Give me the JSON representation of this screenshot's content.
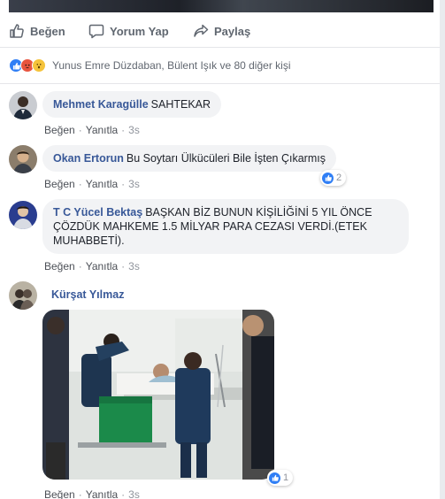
{
  "actions": {
    "like": "Beğen",
    "comment": "Yorum Yap",
    "share": "Paylaş"
  },
  "reactions": {
    "icons": [
      "like-icon",
      "angry-icon",
      "wow-icon"
    ],
    "summary": "Yunus Emre Düzdaban, Bülent Işık ve 80 diğer kişi"
  },
  "colors": {
    "link": "#385898",
    "bubble": "#f2f3f5",
    "like_blue": "#2f7ef5"
  },
  "comments": [
    {
      "author": "Mehmet Karagülle",
      "text": "SAHTEKAR",
      "like": "Beğen",
      "reply": "Yanıtla",
      "time": "3s"
    },
    {
      "author": "Okan Ertorun",
      "text": "Bu Soytarı Ülkücüleri Bile İşten Çıkarmış",
      "like": "Beğen",
      "reply": "Yanıtla",
      "time": "3s",
      "reaction_count": "2"
    },
    {
      "author": "T C Yücel Bektaş",
      "text": "BAŞKAN BİZ BUNUN KİŞİLİĞİNİ 5 YIL ÖNCE ÇÖZDÜK MAHKEME 1.5 MİLYAR PARA CEZASI VERDİ.(ETEK MUHABBETİ).",
      "like": "Beğen",
      "reply": "Yanıtla",
      "time": "3s"
    },
    {
      "author": "Kürşat Yılmaz",
      "like": "Beğen",
      "reply": "Yanıtla",
      "time": "3s",
      "reaction_count": "1",
      "photo": "hospital-photo"
    }
  ]
}
